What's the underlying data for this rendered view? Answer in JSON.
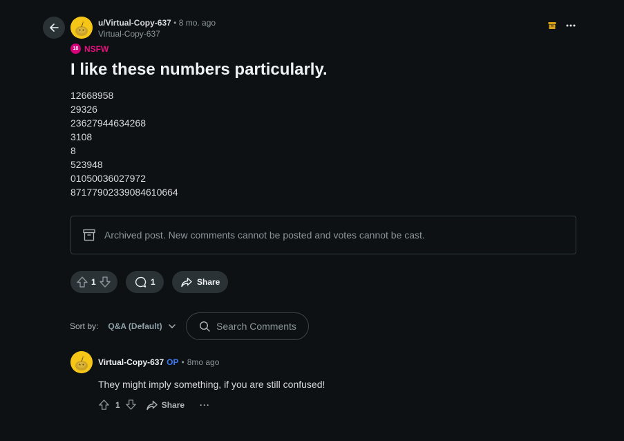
{
  "post": {
    "username": "u/Virtual-Copy-637",
    "separator": "•",
    "time": "8 mo. ago",
    "handle": "Virtual-Copy-637",
    "nsfw_badge": "18",
    "nsfw_label": "NSFW",
    "title": "I like these numbers particularly.",
    "body_lines": [
      "12668958",
      "29326",
      "23627944634268",
      "3108",
      "8",
      "523948",
      "01050036027972",
      "87177902339084610664"
    ],
    "archived_notice": "Archived post. New comments cannot be posted and votes cannot be cast.",
    "vote_count": "1",
    "comment_count": "1",
    "share_label": "Share"
  },
  "comments_bar": {
    "sort_label": "Sort by:",
    "sort_value": "Q&A (Default)",
    "search_placeholder": "Search Comments"
  },
  "comment": {
    "username": "Virtual-Copy-637",
    "op_label": "OP",
    "separator": "•",
    "time": "8mo ago",
    "text": "They might imply something, if you are still confused!",
    "vote_count": "1",
    "share_label": "Share",
    "more_label": "···"
  },
  "icons": {
    "back": "arrow-left-icon",
    "archive": "archive-box-icon",
    "more": "overflow-menu-icon",
    "upvote": "upvote-arrow-icon",
    "downvote": "downvote-arrow-icon",
    "comment": "speech-bubble-icon",
    "share": "share-arrow-icon",
    "search": "search-icon",
    "chevron": "chevron-down-icon"
  },
  "colors": {
    "background": "#0e1113",
    "nsfw": "#e5117f",
    "op": "#3d79f2",
    "archive_icon": "#d4a017",
    "avatar": "#f5c518"
  }
}
